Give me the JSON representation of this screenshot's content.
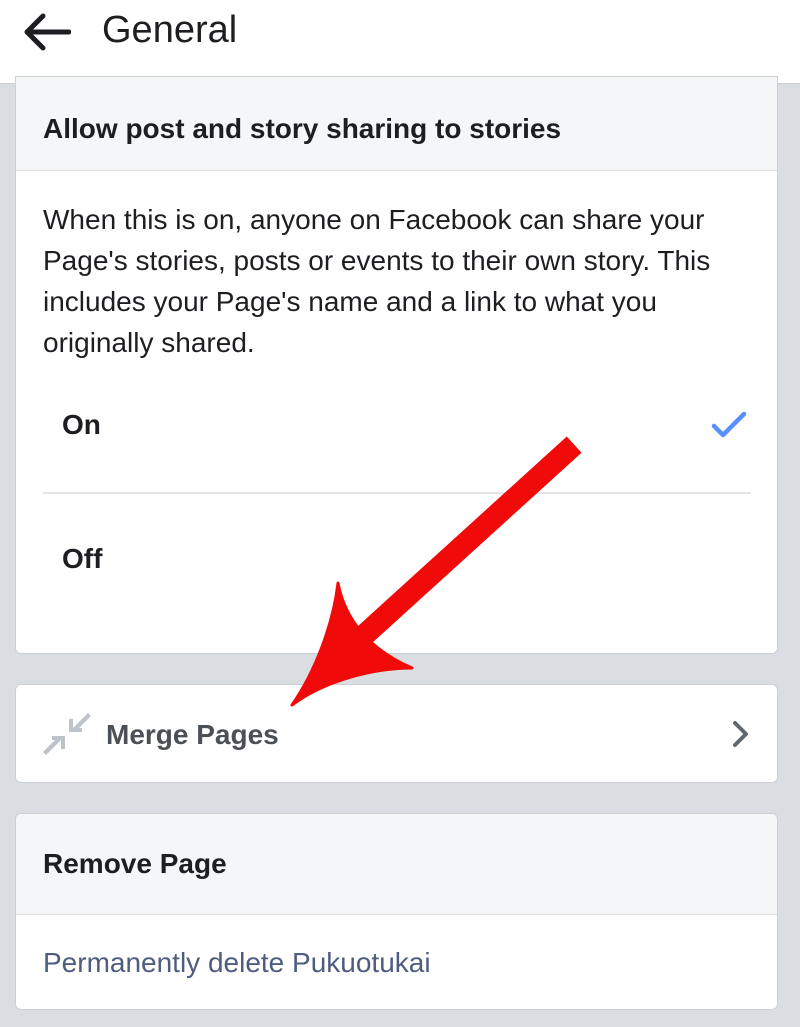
{
  "header": {
    "title": "General",
    "back_icon": "arrow-left-icon"
  },
  "story_sharing": {
    "heading": "Allow post and story sharing to stories",
    "description": "When this is on, anyone on Facebook can share your Page's stories, posts or events to their own story. This includes your Page's name and a link to what you originally shared.",
    "options": [
      {
        "label": "On",
        "selected": true
      },
      {
        "label": "Off",
        "selected": false
      }
    ],
    "check_icon": "checkmark-icon",
    "check_color": "#5890ff"
  },
  "merge_pages": {
    "label": "Merge Pages",
    "icon": "merge-arrows-icon",
    "chevron_icon": "chevron-right-icon"
  },
  "remove_page": {
    "heading": "Remove Page",
    "link": "Permanently delete Pukuotukai",
    "link_color": "#4d5d80"
  },
  "annotation": {
    "type": "arrow",
    "color": "#f00a0a",
    "points_to": "merge-pages"
  }
}
